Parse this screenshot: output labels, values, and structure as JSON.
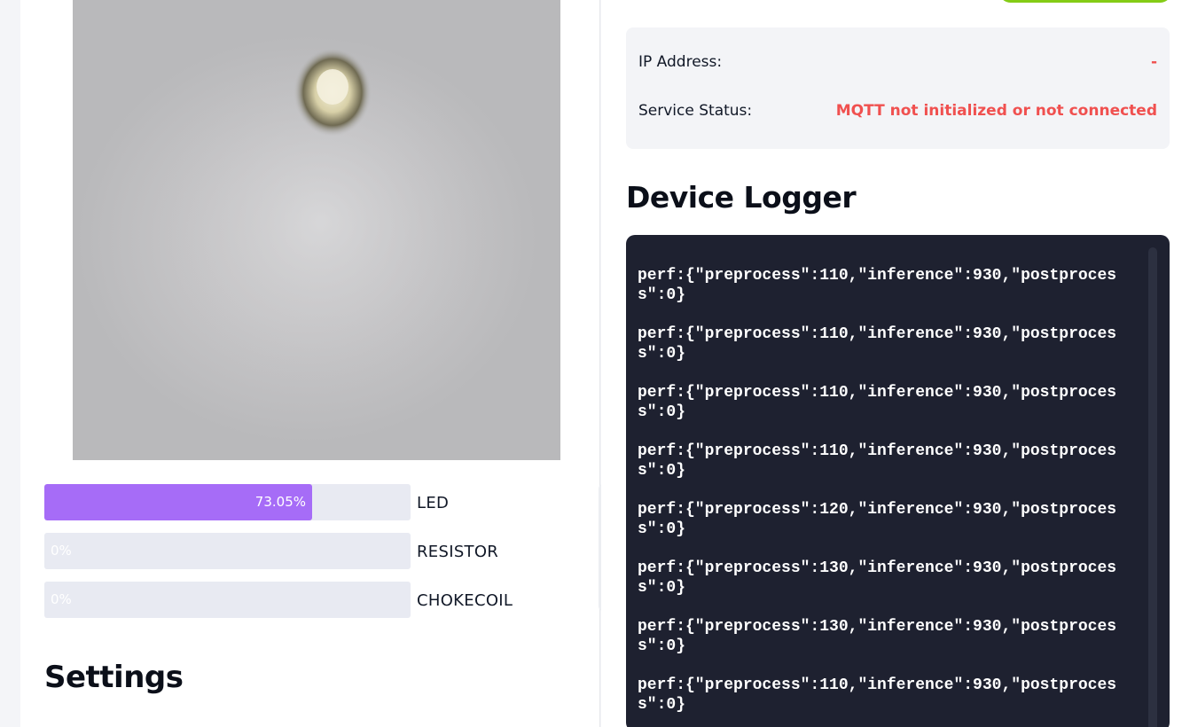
{
  "predictions": [
    {
      "label": "LED",
      "value_text": "73.05%",
      "fraction": 0.7305
    },
    {
      "label": "RESISTOR",
      "value_text": "0%",
      "fraction": 0
    },
    {
      "label": "CHOKECOIL",
      "value_text": "0%",
      "fraction": 0
    }
  ],
  "settings": {
    "title": "Settings"
  },
  "device_info": {
    "ip_label": "IP Address:",
    "ip_value": "-",
    "status_label": "Service Status:",
    "status_value": "MQTT not initialized or not connected",
    "error_color": "#f0504f"
  },
  "logger": {
    "title": "Device Logger",
    "lines": [
      "perf:{\"preprocess\":110,\"inference\":930,\"postprocess\":0}",
      "perf:{\"preprocess\":110,\"inference\":930,\"postprocess\":0}",
      "perf:{\"preprocess\":110,\"inference\":930,\"postprocess\":0}",
      "perf:{\"preprocess\":110,\"inference\":930,\"postprocess\":0}",
      "perf:{\"preprocess\":120,\"inference\":930,\"postprocess\":0}",
      "perf:{\"preprocess\":130,\"inference\":930,\"postprocess\":0}",
      "perf:{\"preprocess\":130,\"inference\":930,\"postprocess\":0}",
      "perf:{\"preprocess\":110,\"inference\":930,\"postprocess\":0}"
    ]
  },
  "colors": {
    "accent": "#a66cf7",
    "top_button": "#84cc16",
    "logger_bg": "#1e2130"
  }
}
